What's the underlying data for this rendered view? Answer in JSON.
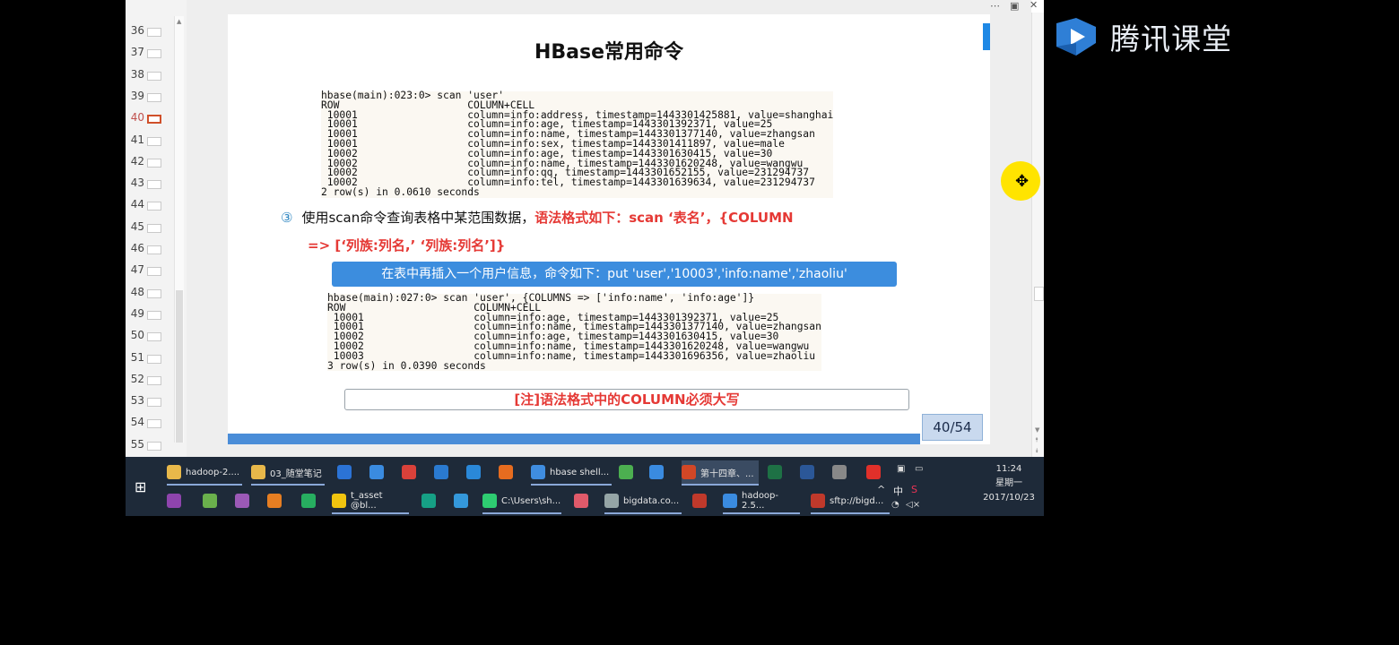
{
  "thumbs": [
    "36",
    "37",
    "38",
    "39",
    "40",
    "41",
    "42",
    "43",
    "44",
    "45",
    "46",
    "47",
    "48",
    "49",
    "50",
    "51",
    "52",
    "53",
    "54",
    "55"
  ],
  "active_thumb": "40",
  "slide": {
    "title": "HBase常用命令",
    "code1": "hbase(main):023:0> scan 'user'\nROW                     COLUMN+CELL\n 10001                  column=info:address, timestamp=1443301425881, value=shanghai\n 10001                  column=info:age, timestamp=1443301392371, value=25\n 10001                  column=info:name, timestamp=1443301377140, value=zhangsan\n 10001                  column=info:sex, timestamp=1443301411897, value=male\n 10002                  column=info:age, timestamp=1443301630415, value=30\n 10002                  column=info:name, timestamp=1443301620248, value=wangwu\n 10002                  column=info:qq, timestamp=1443301652155, value=231294737\n 10002                  column=info:tel, timestamp=1443301639634, value=231294737\n2 row(s) in 0.0610 seconds",
    "bullet_num": "③",
    "bullet_text": "使用scan命令查询表格中某范围数据，",
    "bullet_red": "语法格式如下：scan  ‘表名’，{COLUMN",
    "bullet_line2": "=> [‘列族:列名,’ ‘列族:列名’]}",
    "blue_box": "在表中再插入一个用户信息，命令如下：put 'user','10003','info:name','zhaoliu'",
    "code2": "hbase(main):027:0> scan 'user', {COLUMNS => ['info:name', 'info:age']}\nROW                     COLUMN+CELL\n 10001                  column=info:age, timestamp=1443301392371, value=25\n 10001                  column=info:name, timestamp=1443301377140, value=zhangsan\n 10002                  column=info:age, timestamp=1443301630415, value=30\n 10002                  column=info:name, timestamp=1443301620248, value=wangwu\n 10003                  column=info:name, timestamp=1443301696356, value=zhaoliu\n3 row(s) in 0.0390 seconds",
    "note": "[注]语法格式中的COLUMN必须大写",
    "page": "40/54"
  },
  "taskbar": {
    "row1": [
      "hadoop-2....",
      "03_随堂笔记",
      "",
      "",
      "",
      "",
      "",
      "",
      "hbase shell...",
      "",
      "",
      "第十四章、...",
      "",
      "",
      "",
      ""
    ],
    "row2": [
      "",
      "",
      "",
      "",
      "",
      "t_asset @bl...",
      "",
      "",
      "C:\\Users\\sh...",
      "",
      "bigdata.co...",
      "",
      "hadoop-2.5...",
      "sftp://bigd..."
    ],
    "tray_ime": "中",
    "time": "11:24",
    "weekday": "星期一",
    "date": "2017/10/23"
  },
  "brand": "腾讯课堂"
}
